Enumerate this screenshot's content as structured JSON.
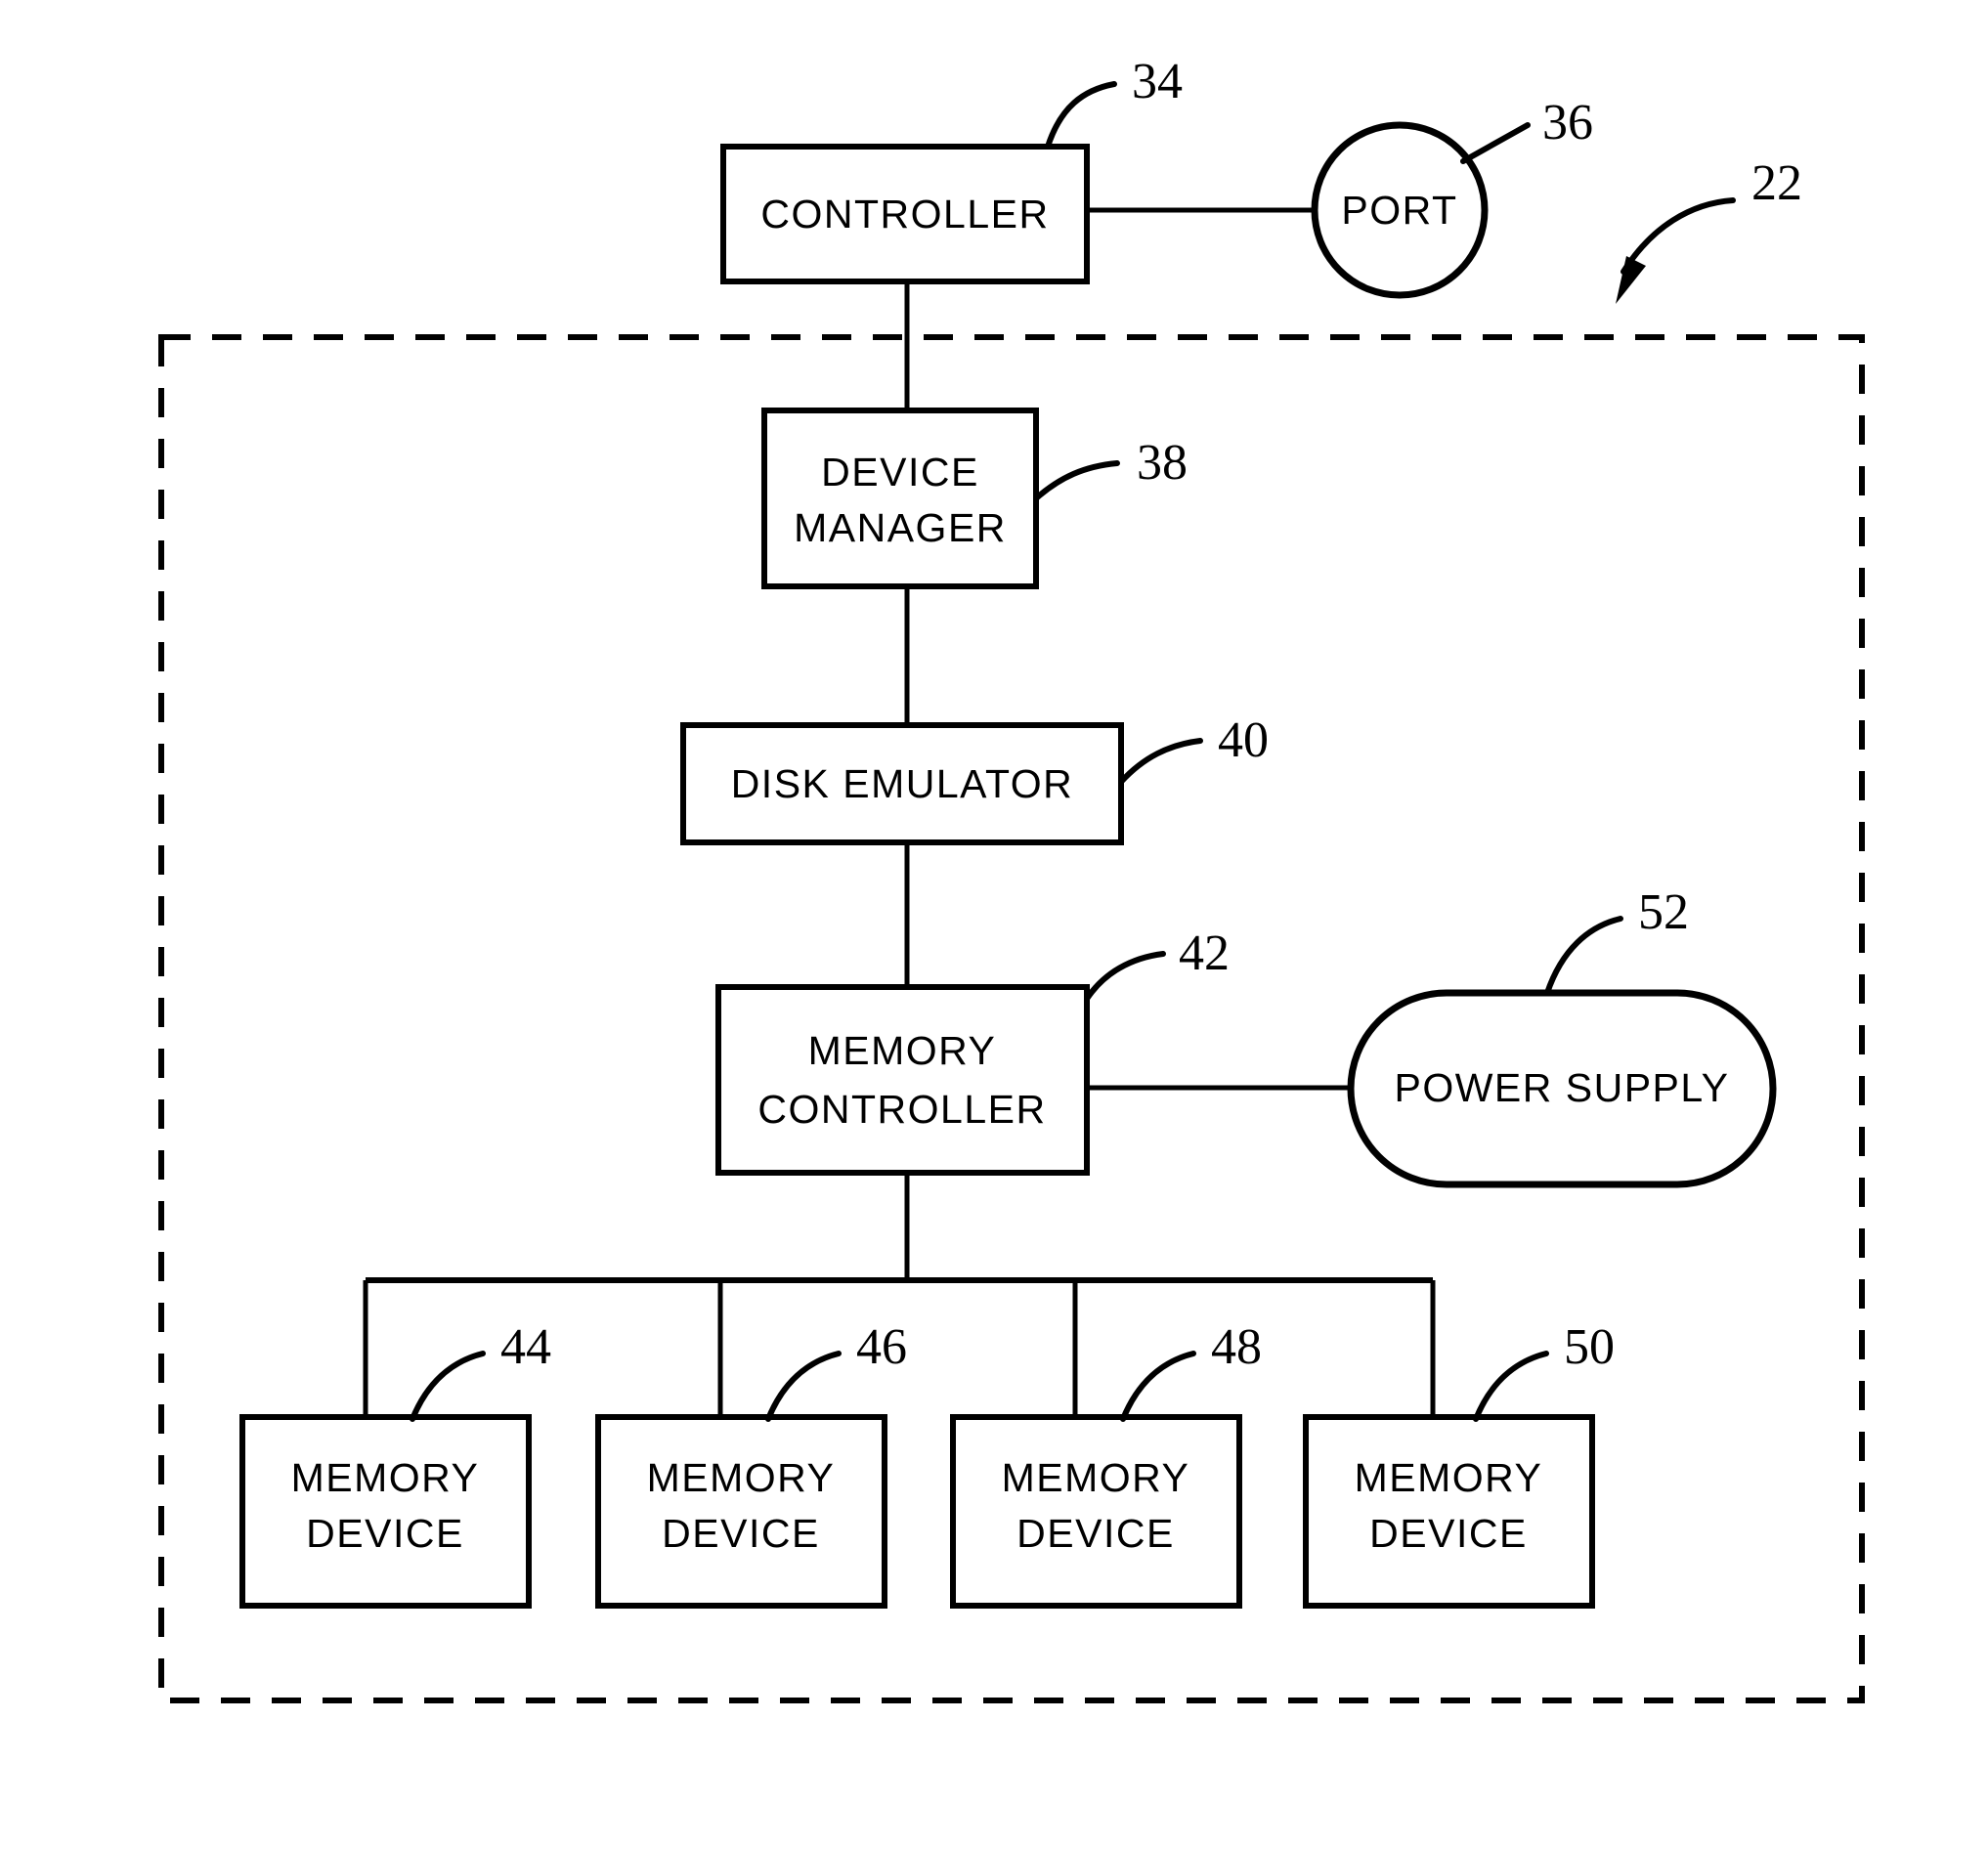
{
  "figure": {
    "type": "patent-block-diagram",
    "assembly_ref": "22"
  },
  "nodes": {
    "controller": {
      "label": "CONTROLLER",
      "ref": "34",
      "shape": "rect"
    },
    "port": {
      "label": "PORT",
      "ref": "36",
      "shape": "circle"
    },
    "device_manager": {
      "label_line1": "DEVICE",
      "label_line2": "MANAGER",
      "ref": "38",
      "shape": "rect"
    },
    "disk_emulator": {
      "label": "DISK  EMULATOR",
      "ref": "40",
      "shape": "rect"
    },
    "memory_controller": {
      "label_line1": "MEMORY",
      "label_line2": "CONTROLLER",
      "ref": "42",
      "shape": "rect"
    },
    "power_supply": {
      "label": "POWER  SUPPLY",
      "ref": "52",
      "shape": "stadium"
    },
    "memory_devices": [
      {
        "label_line1": "MEMORY",
        "label_line2": "DEVICE",
        "ref": "44",
        "shape": "rect"
      },
      {
        "label_line1": "MEMORY",
        "label_line2": "DEVICE",
        "ref": "46",
        "shape": "rect"
      },
      {
        "label_line1": "MEMORY",
        "label_line2": "DEVICE",
        "ref": "48",
        "shape": "rect"
      },
      {
        "label_line1": "MEMORY",
        "label_line2": "DEVICE",
        "ref": "50",
        "shape": "rect"
      }
    ]
  },
  "enclosure": {
    "ref": "22",
    "style": "dashed"
  },
  "colors": {
    "ink": "#000000",
    "paper": "#ffffff"
  }
}
